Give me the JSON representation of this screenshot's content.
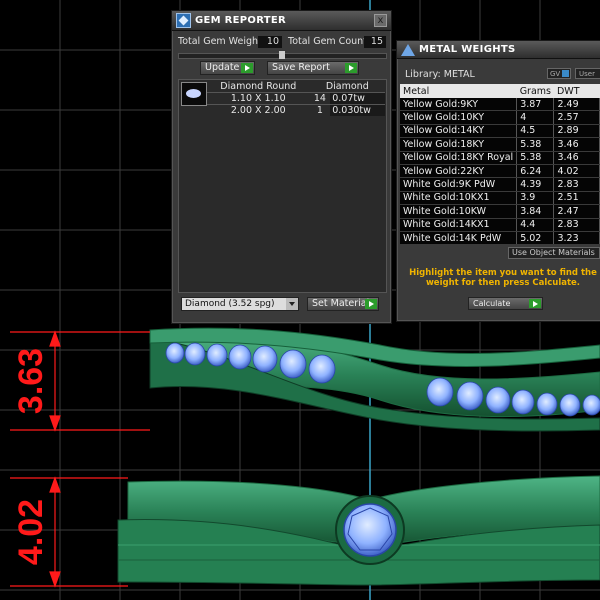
{
  "gem_reporter": {
    "title": "GEM REPORTER",
    "close_label": "x",
    "total_gem_weight_label": "Total Gem Weight",
    "total_gem_weight_value": "10",
    "total_gem_count_label": "Total Gem Count",
    "total_gem_count_value": "15",
    "update_label": "Update",
    "save_report_label": "Save Report",
    "table_headers": [
      "Diamond Round",
      "Diamond"
    ],
    "rows": [
      {
        "size": "1.10 X 1.10",
        "count": "14",
        "weight": "0.07tw"
      },
      {
        "size": "2.00 X 2.00",
        "count": "1",
        "weight": "0.030tw"
      }
    ],
    "material_select": "Diamond    (3.52 spg)",
    "set_material_label": "Set Material"
  },
  "metal_weights": {
    "title": "METAL WEIGHTS",
    "library_label": "Library: METAL",
    "gv_label": "GV",
    "user_label": "User",
    "columns": [
      "Metal",
      "Grams",
      "DWT"
    ],
    "rows": [
      {
        "metal": "Yellow Gold:9KY",
        "grams": "3.87",
        "dwt": "2.49"
      },
      {
        "metal": "Yellow Gold:10KY",
        "grams": "4",
        "dwt": "2.57"
      },
      {
        "metal": "Yellow Gold:14KY",
        "grams": "4.5",
        "dwt": "2.89"
      },
      {
        "metal": "Yellow Gold:18KY",
        "grams": "5.38",
        "dwt": "3.46"
      },
      {
        "metal": "Yellow Gold:18KY Royal",
        "grams": "5.38",
        "dwt": "3.46"
      },
      {
        "metal": "Yellow Gold:22KY",
        "grams": "6.24",
        "dwt": "4.02"
      },
      {
        "metal": "White Gold:9K PdW",
        "grams": "4.39",
        "dwt": "2.83"
      },
      {
        "metal": "White Gold:10KX1",
        "grams": "3.9",
        "dwt": "2.51"
      },
      {
        "metal": "White Gold:10KW",
        "grams": "3.84",
        "dwt": "2.47"
      },
      {
        "metal": "White Gold:14KX1",
        "grams": "4.4",
        "dwt": "2.83"
      },
      {
        "metal": "White Gold:14K PdW",
        "grams": "5.02",
        "dwt": "3.23"
      }
    ],
    "use_object_materials_label": "Use Object Materials",
    "instruction": "Highlight the item you want to find the weight for then press Calculate.",
    "calculate_label": "Calculate"
  },
  "dimensions": {
    "top": "3.63",
    "bottom": "4.02"
  },
  "colors": {
    "ring_green": "#2c8a5e",
    "gem_blue": "#7aa6ff",
    "dimension_red": "#ff1a1a",
    "grid": "#3a3a3a"
  }
}
